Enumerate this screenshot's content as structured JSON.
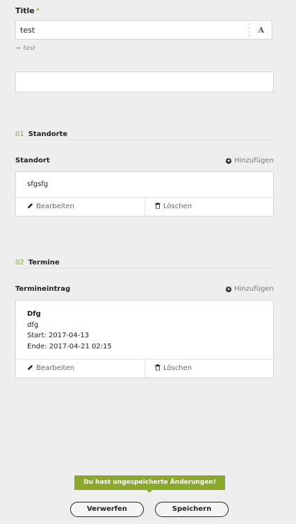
{
  "title_field": {
    "label": "Title",
    "required_mark": "*",
    "value": "test",
    "format_icon": "A",
    "slug": "test",
    "slug_arrow_icon": "arrow-right"
  },
  "second_field": {
    "value": ""
  },
  "sections": [
    {
      "number": "01",
      "name": "Standorte"
    },
    {
      "number": "02",
      "name": "Termine"
    }
  ],
  "standort": {
    "group_title": "Standort",
    "add_label": "Hinzufügen",
    "entries": [
      {
        "text": "sfgsfg",
        "edit_label": "Bearbeiten",
        "delete_label": "Löschen"
      }
    ]
  },
  "termineintrag": {
    "group_title": "Termineintrag",
    "add_label": "Hinzufügen",
    "entries": [
      {
        "title": "Dfg",
        "subtitle": "dfg",
        "start": "Start: 2017-04-13",
        "end": "Ende: 2017-04-21 02:15",
        "edit_label": "Bearbeiten",
        "delete_label": "Löschen"
      }
    ]
  },
  "footer": {
    "unsaved_message": "Du hast ungespeicherte Änderungen!",
    "discard_label": "Verwerfen",
    "save_label": "Speichern"
  },
  "colors": {
    "accent": "#8aa82a",
    "background": "#eeeeee"
  }
}
